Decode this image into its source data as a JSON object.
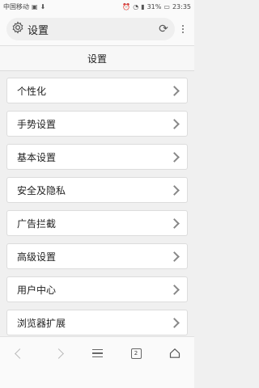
{
  "status_bar": {
    "carrier": "中国移动",
    "battery": "31%",
    "time": "23:35"
  },
  "address_bar": {
    "title": "设置",
    "icon": "gear-icon",
    "reload_icon": "reload-icon"
  },
  "page": {
    "header": "设置"
  },
  "settings": {
    "items": [
      {
        "label": "个性化"
      },
      {
        "label": "手势设置"
      },
      {
        "label": "基本设置"
      },
      {
        "label": "安全及隐私"
      },
      {
        "label": "广告拦截"
      },
      {
        "label": "高级设置"
      },
      {
        "label": "用户中心"
      },
      {
        "label": "浏览器扩展"
      }
    ]
  },
  "bottom_bar": {
    "tab_count": "2"
  }
}
